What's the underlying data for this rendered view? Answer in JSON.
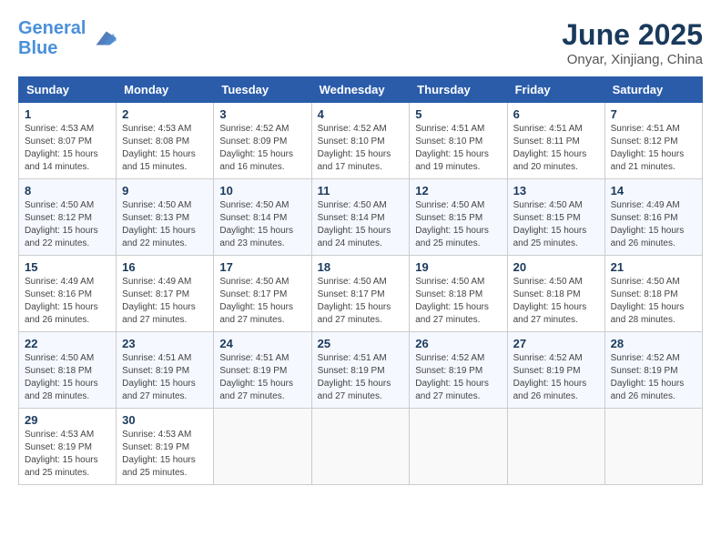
{
  "header": {
    "logo_line1": "General",
    "logo_line2": "Blue",
    "month": "June 2025",
    "location": "Onyar, Xinjiang, China"
  },
  "weekdays": [
    "Sunday",
    "Monday",
    "Tuesday",
    "Wednesday",
    "Thursday",
    "Friday",
    "Saturday"
  ],
  "weeks": [
    [
      {
        "day": "1",
        "sunrise": "Sunrise: 4:53 AM",
        "sunset": "Sunset: 8:07 PM",
        "daylight": "Daylight: 15 hours and 14 minutes."
      },
      {
        "day": "2",
        "sunrise": "Sunrise: 4:53 AM",
        "sunset": "Sunset: 8:08 PM",
        "daylight": "Daylight: 15 hours and 15 minutes."
      },
      {
        "day": "3",
        "sunrise": "Sunrise: 4:52 AM",
        "sunset": "Sunset: 8:09 PM",
        "daylight": "Daylight: 15 hours and 16 minutes."
      },
      {
        "day": "4",
        "sunrise": "Sunrise: 4:52 AM",
        "sunset": "Sunset: 8:10 PM",
        "daylight": "Daylight: 15 hours and 17 minutes."
      },
      {
        "day": "5",
        "sunrise": "Sunrise: 4:51 AM",
        "sunset": "Sunset: 8:10 PM",
        "daylight": "Daylight: 15 hours and 19 minutes."
      },
      {
        "day": "6",
        "sunrise": "Sunrise: 4:51 AM",
        "sunset": "Sunset: 8:11 PM",
        "daylight": "Daylight: 15 hours and 20 minutes."
      },
      {
        "day": "7",
        "sunrise": "Sunrise: 4:51 AM",
        "sunset": "Sunset: 8:12 PM",
        "daylight": "Daylight: 15 hours and 21 minutes."
      }
    ],
    [
      {
        "day": "8",
        "sunrise": "Sunrise: 4:50 AM",
        "sunset": "Sunset: 8:12 PM",
        "daylight": "Daylight: 15 hours and 22 minutes."
      },
      {
        "day": "9",
        "sunrise": "Sunrise: 4:50 AM",
        "sunset": "Sunset: 8:13 PM",
        "daylight": "Daylight: 15 hours and 22 minutes."
      },
      {
        "day": "10",
        "sunrise": "Sunrise: 4:50 AM",
        "sunset": "Sunset: 8:14 PM",
        "daylight": "Daylight: 15 hours and 23 minutes."
      },
      {
        "day": "11",
        "sunrise": "Sunrise: 4:50 AM",
        "sunset": "Sunset: 8:14 PM",
        "daylight": "Daylight: 15 hours and 24 minutes."
      },
      {
        "day": "12",
        "sunrise": "Sunrise: 4:50 AM",
        "sunset": "Sunset: 8:15 PM",
        "daylight": "Daylight: 15 hours and 25 minutes."
      },
      {
        "day": "13",
        "sunrise": "Sunrise: 4:50 AM",
        "sunset": "Sunset: 8:15 PM",
        "daylight": "Daylight: 15 hours and 25 minutes."
      },
      {
        "day": "14",
        "sunrise": "Sunrise: 4:49 AM",
        "sunset": "Sunset: 8:16 PM",
        "daylight": "Daylight: 15 hours and 26 minutes."
      }
    ],
    [
      {
        "day": "15",
        "sunrise": "Sunrise: 4:49 AM",
        "sunset": "Sunset: 8:16 PM",
        "daylight": "Daylight: 15 hours and 26 minutes."
      },
      {
        "day": "16",
        "sunrise": "Sunrise: 4:49 AM",
        "sunset": "Sunset: 8:17 PM",
        "daylight": "Daylight: 15 hours and 27 minutes."
      },
      {
        "day": "17",
        "sunrise": "Sunrise: 4:50 AM",
        "sunset": "Sunset: 8:17 PM",
        "daylight": "Daylight: 15 hours and 27 minutes."
      },
      {
        "day": "18",
        "sunrise": "Sunrise: 4:50 AM",
        "sunset": "Sunset: 8:17 PM",
        "daylight": "Daylight: 15 hours and 27 minutes."
      },
      {
        "day": "19",
        "sunrise": "Sunrise: 4:50 AM",
        "sunset": "Sunset: 8:18 PM",
        "daylight": "Daylight: 15 hours and 27 minutes."
      },
      {
        "day": "20",
        "sunrise": "Sunrise: 4:50 AM",
        "sunset": "Sunset: 8:18 PM",
        "daylight": "Daylight: 15 hours and 27 minutes."
      },
      {
        "day": "21",
        "sunrise": "Sunrise: 4:50 AM",
        "sunset": "Sunset: 8:18 PM",
        "daylight": "Daylight: 15 hours and 28 minutes."
      }
    ],
    [
      {
        "day": "22",
        "sunrise": "Sunrise: 4:50 AM",
        "sunset": "Sunset: 8:18 PM",
        "daylight": "Daylight: 15 hours and 28 minutes."
      },
      {
        "day": "23",
        "sunrise": "Sunrise: 4:51 AM",
        "sunset": "Sunset: 8:19 PM",
        "daylight": "Daylight: 15 hours and 27 minutes."
      },
      {
        "day": "24",
        "sunrise": "Sunrise: 4:51 AM",
        "sunset": "Sunset: 8:19 PM",
        "daylight": "Daylight: 15 hours and 27 minutes."
      },
      {
        "day": "25",
        "sunrise": "Sunrise: 4:51 AM",
        "sunset": "Sunset: 8:19 PM",
        "daylight": "Daylight: 15 hours and 27 minutes."
      },
      {
        "day": "26",
        "sunrise": "Sunrise: 4:52 AM",
        "sunset": "Sunset: 8:19 PM",
        "daylight": "Daylight: 15 hours and 27 minutes."
      },
      {
        "day": "27",
        "sunrise": "Sunrise: 4:52 AM",
        "sunset": "Sunset: 8:19 PM",
        "daylight": "Daylight: 15 hours and 26 minutes."
      },
      {
        "day": "28",
        "sunrise": "Sunrise: 4:52 AM",
        "sunset": "Sunset: 8:19 PM",
        "daylight": "Daylight: 15 hours and 26 minutes."
      }
    ],
    [
      {
        "day": "29",
        "sunrise": "Sunrise: 4:53 AM",
        "sunset": "Sunset: 8:19 PM",
        "daylight": "Daylight: 15 hours and 25 minutes."
      },
      {
        "day": "30",
        "sunrise": "Sunrise: 4:53 AM",
        "sunset": "Sunset: 8:19 PM",
        "daylight": "Daylight: 15 hours and 25 minutes."
      },
      null,
      null,
      null,
      null,
      null
    ]
  ]
}
